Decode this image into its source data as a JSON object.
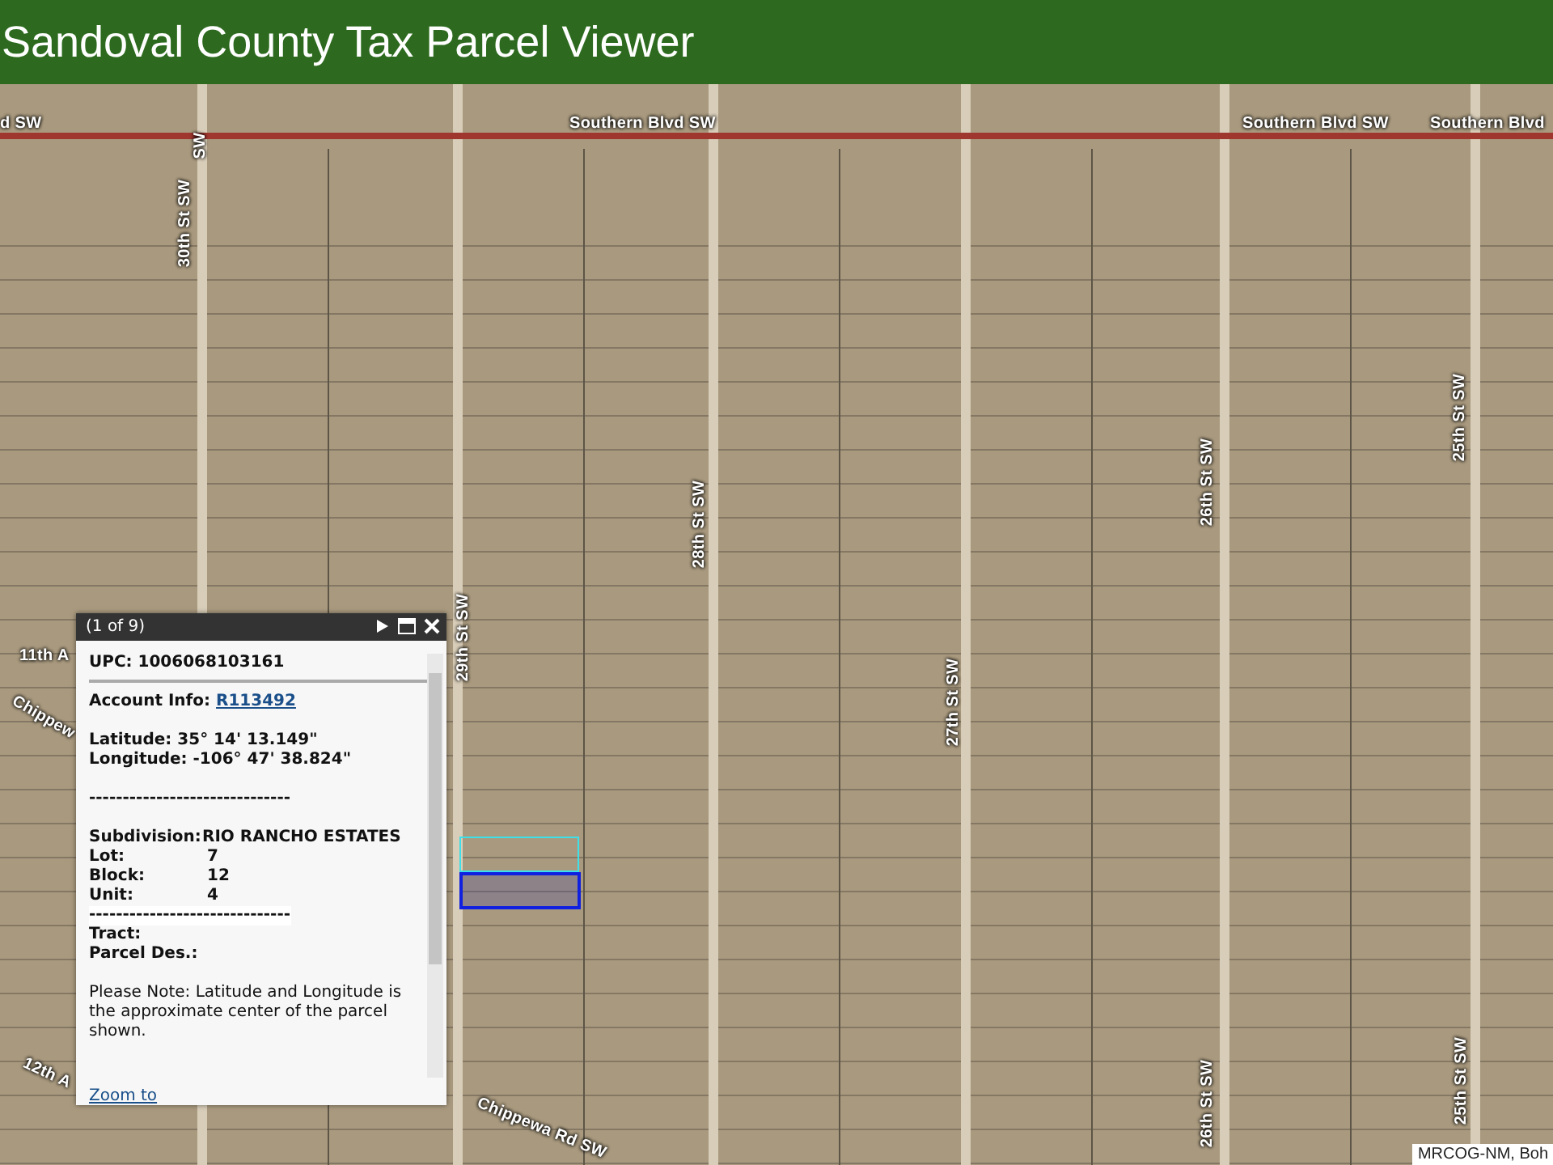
{
  "header": {
    "title": "Sandoval County Tax Parcel Viewer"
  },
  "map": {
    "road_labels": [
      {
        "text": "d SW",
        "kind": "horizontal"
      },
      {
        "text": "Southern Blvd SW",
        "kind": "horizontal"
      },
      {
        "text": "Southern Blvd SW",
        "kind": "horizontal"
      },
      {
        "text": "Southern Blvd",
        "kind": "horizontal"
      },
      {
        "text": "SW",
        "kind": "vertical"
      },
      {
        "text": "30th St SW",
        "kind": "vertical"
      },
      {
        "text": "29th St SW",
        "kind": "vertical"
      },
      {
        "text": "28th St SW",
        "kind": "vertical"
      },
      {
        "text": "27th St SW",
        "kind": "vertical"
      },
      {
        "text": "26th St SW",
        "kind": "vertical"
      },
      {
        "text": "26th St SW",
        "kind": "vertical"
      },
      {
        "text": "25th St SW",
        "kind": "vertical"
      },
      {
        "text": "25th St SW",
        "kind": "vertical"
      },
      {
        "text": "11th A",
        "kind": "horizontal"
      },
      {
        "text": "Chippew",
        "kind": "diagonal"
      },
      {
        "text": "12th A",
        "kind": "diagonal"
      },
      {
        "text": "Chippewa Rd SW",
        "kind": "diagonal"
      }
    ],
    "attribution": "MRCOG-NM, Boh"
  },
  "popup": {
    "counter": "(1 of 9)",
    "upc": "UPC: 1006068103161",
    "account_label": "Account Info:",
    "account_link": "R113492",
    "latitude": "Latitude: 35° 14' 13.149\"",
    "longitude": "Longitude: -106° 47' 38.824\"",
    "separator": "------------------------------",
    "fields": [
      {
        "label": "Subdivision:",
        "value": "RIO RANCHO ESTATES"
      },
      {
        "label": "Lot:",
        "value": "7"
      },
      {
        "label": "Block:",
        "value": "12"
      },
      {
        "label": "Unit:",
        "value": "4"
      }
    ],
    "separator_2": "------------------------------",
    "fields_2": [
      {
        "label": "Tract:"
      },
      {
        "label": "Parcel Des.:"
      }
    ],
    "note": "Please Note: Latitude and Longitude is the approximate center of the parcel shown.",
    "zoom_link": "Zoom to"
  }
}
